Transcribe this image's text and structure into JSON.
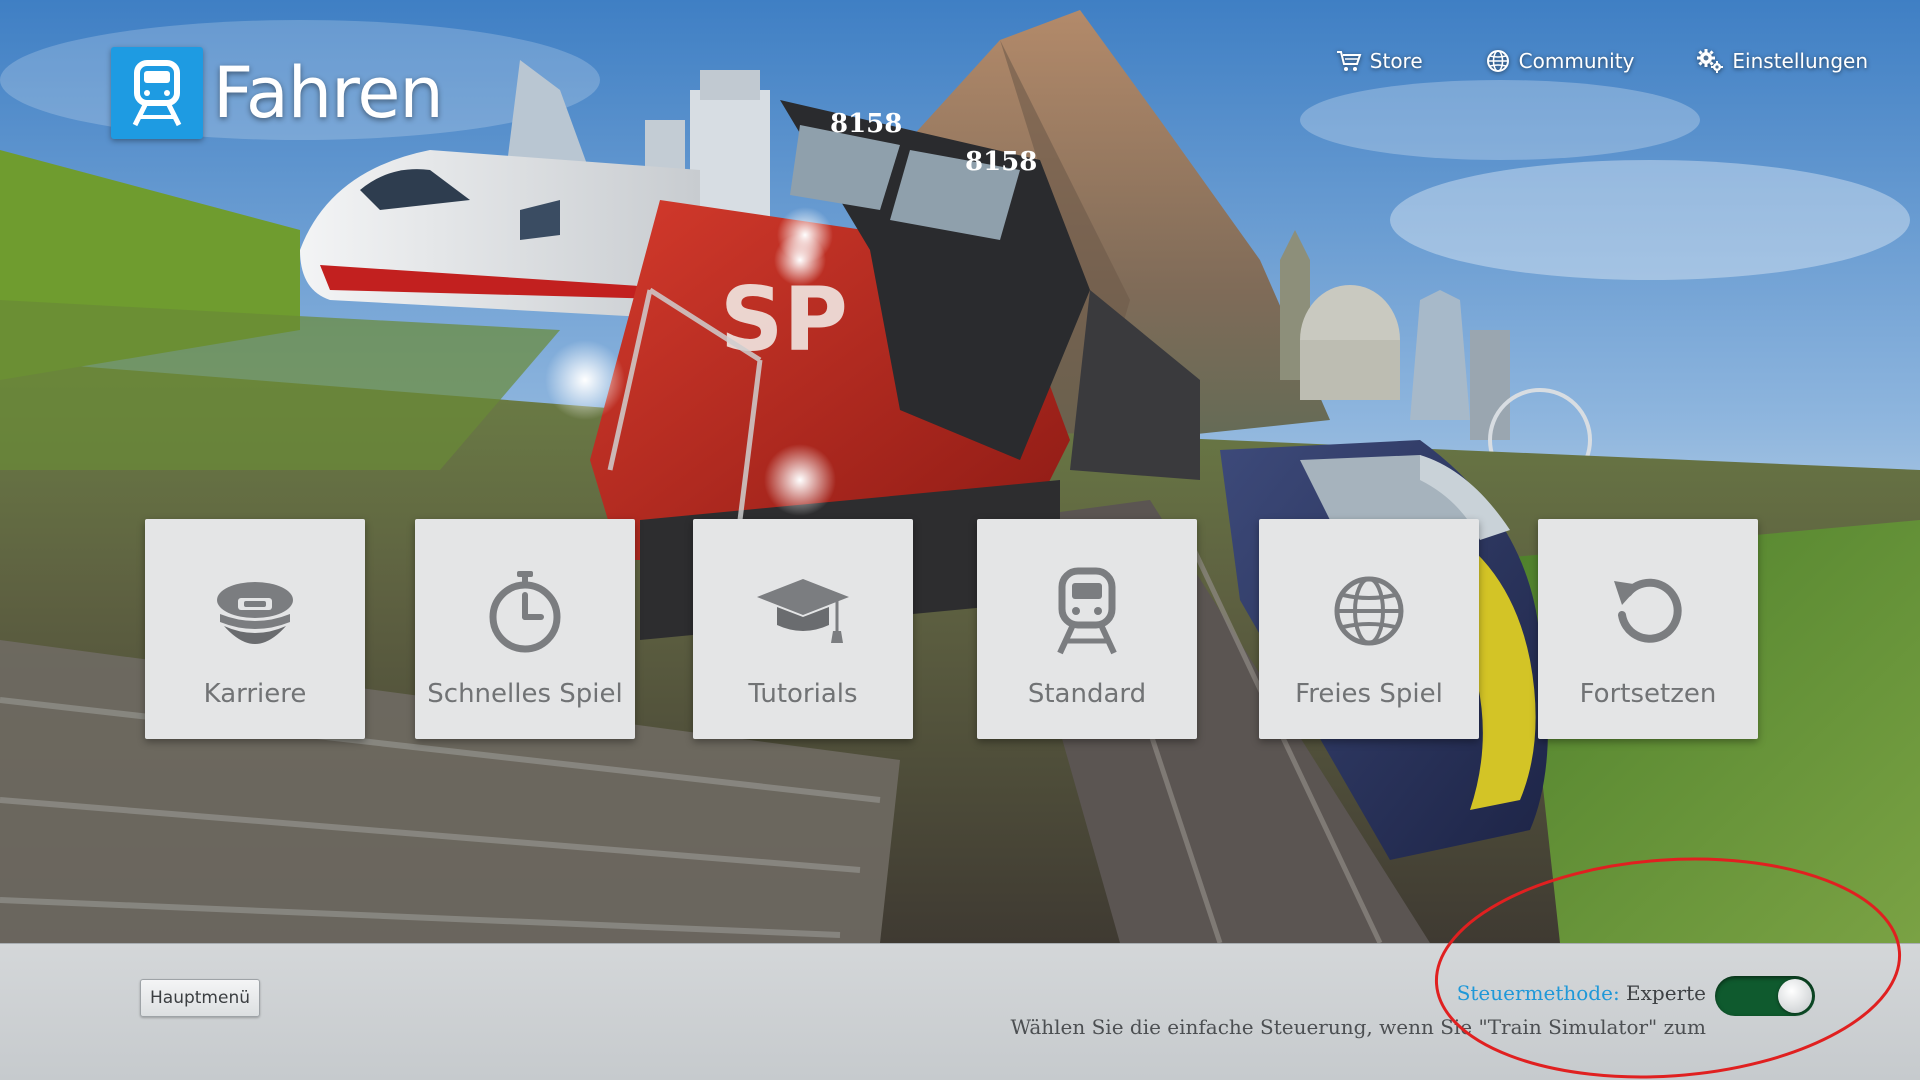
{
  "header": {
    "title": "Fahren",
    "nav": [
      {
        "label": "Store",
        "icon": "cart-icon"
      },
      {
        "label": "Community",
        "icon": "globe-icon"
      },
      {
        "label": "Einstellungen",
        "icon": "gears-icon"
      }
    ]
  },
  "tiles": [
    {
      "label": "Karriere",
      "icon": "conductor-cap-icon"
    },
    {
      "label": "Schnelles Spiel",
      "icon": "stopwatch-icon"
    },
    {
      "label": "Tutorials",
      "icon": "graduation-cap-icon"
    },
    {
      "label": "Standard",
      "icon": "train-icon"
    },
    {
      "label": "Freies Spiel",
      "icon": "globe-icon"
    },
    {
      "label": "Fortsetzen",
      "icon": "restart-arrow-icon"
    }
  ],
  "footer": {
    "main_menu_label": "Hauptmenü",
    "control_method_label": "Steuermethode:",
    "control_method_value": "Experte",
    "toggle_on": true,
    "hint": "Wählen Sie die einfache Steuerung, wenn Sie \"Train Simulator\" zum"
  },
  "colors": {
    "accent": "#1e9be2",
    "toggle_on": "#0f5a2e",
    "tile_bg": "#e4e5e6",
    "tile_text": "#717375",
    "annotation": "#e02020"
  }
}
